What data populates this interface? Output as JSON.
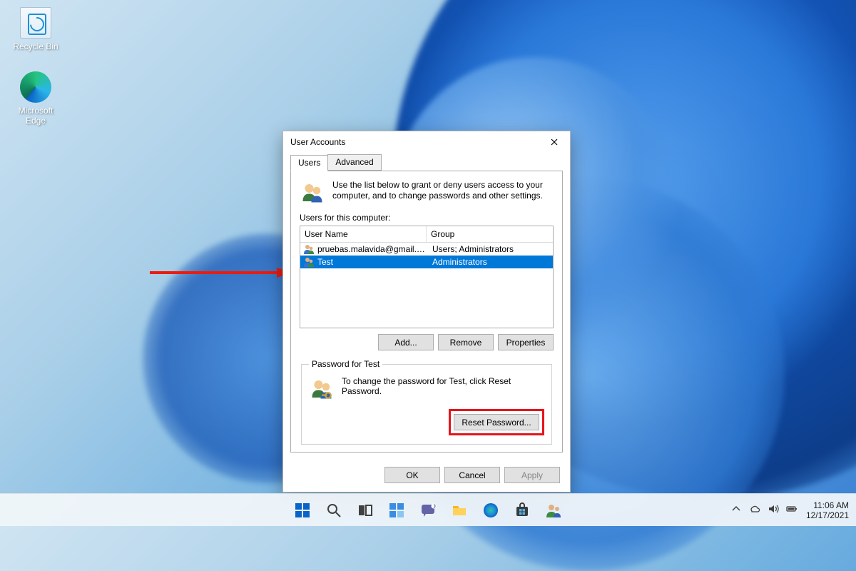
{
  "desktop": {
    "icons": [
      {
        "label": "Recycle Bin"
      },
      {
        "label": "Microsoft Edge"
      }
    ]
  },
  "dialog": {
    "title": "User Accounts",
    "tabs": {
      "users": "Users",
      "advanced": "Advanced"
    },
    "intro_text": "Use the list below to grant or deny users access to your computer, and to change passwords and other settings.",
    "list_label": "Users for this computer:",
    "columns": {
      "user": "User Name",
      "group": "Group"
    },
    "rows": [
      {
        "user": "pruebas.malavida@gmail.com",
        "group": "Users; Administrators",
        "selected": false
      },
      {
        "user": "Test",
        "group": "Administrators",
        "selected": true
      }
    ],
    "buttons": {
      "add": "Add...",
      "remove": "Remove",
      "properties": "Properties"
    },
    "password_box": {
      "legend": "Password for Test",
      "text": "To change the password for Test, click Reset Password.",
      "reset": "Reset Password..."
    },
    "footer": {
      "ok": "OK",
      "cancel": "Cancel",
      "apply": "Apply"
    }
  },
  "taskbar": {
    "time": "11:06 AM",
    "date": "12/17/2021"
  }
}
